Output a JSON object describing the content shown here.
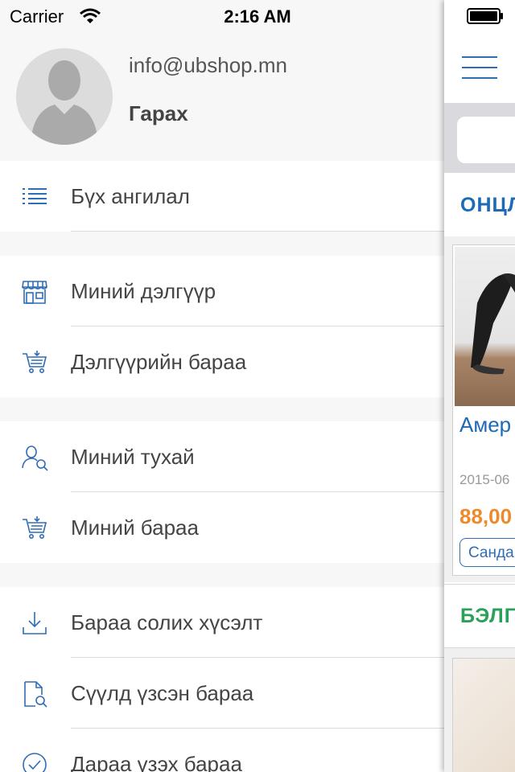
{
  "status_bar": {
    "carrier": "Carrier",
    "time": "2:16 AM"
  },
  "profile": {
    "email": "info@ubshop.mn",
    "name": "Гарах"
  },
  "menu": {
    "groups": [
      [
        {
          "label": "Бүх ангилал",
          "icon": "list-icon"
        }
      ],
      [
        {
          "label": "Миний дэлгүүр",
          "icon": "store-icon"
        },
        {
          "label": "Дэлгүүрийн бараа",
          "icon": "cart-icon"
        }
      ],
      [
        {
          "label": "Миний тухай",
          "icon": "user-search-icon"
        },
        {
          "label": "Миний бараа",
          "icon": "cart-icon"
        }
      ],
      [
        {
          "label": "Бараа солих хүсэлт",
          "icon": "download-icon"
        },
        {
          "label": "Сүүлд үзсэн бараа",
          "icon": "document-search-icon"
        },
        {
          "label": "Дараа үзэх бараа",
          "icon": "check-circle-icon"
        }
      ]
    ]
  },
  "main": {
    "section1_title": "ОНЦЛ",
    "section2_title": "БЭЛГ",
    "product": {
      "title": "Амер санда",
      "date": "2015-06",
      "price": "88,00",
      "tag": "Санда"
    }
  },
  "colors": {
    "accent_blue": "#1e6ab6",
    "price_orange": "#ee8a2c",
    "green": "#2aa15a"
  }
}
